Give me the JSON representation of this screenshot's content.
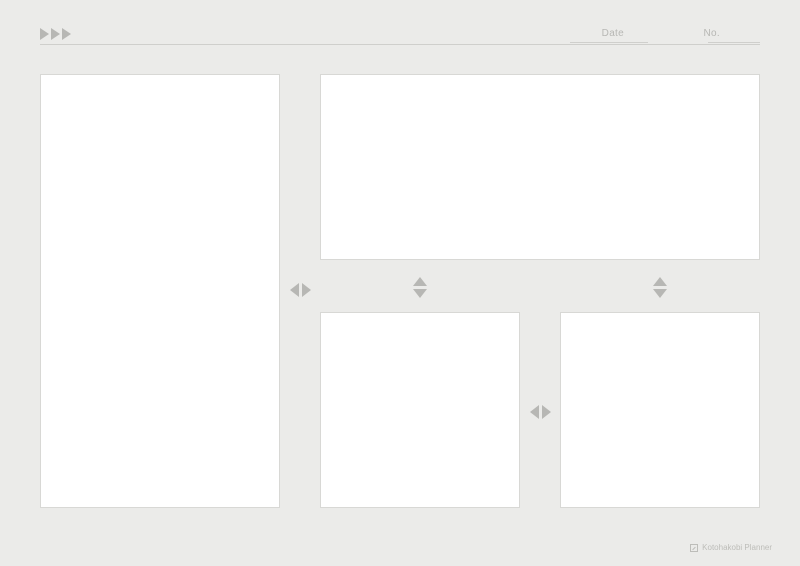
{
  "header": {
    "date_label": "Date",
    "no_label": "No."
  },
  "panels": {
    "left": "",
    "top": "",
    "bottom_left": "",
    "bottom_right": ""
  },
  "footer": {
    "brand": "Kotohakobi Planner"
  }
}
